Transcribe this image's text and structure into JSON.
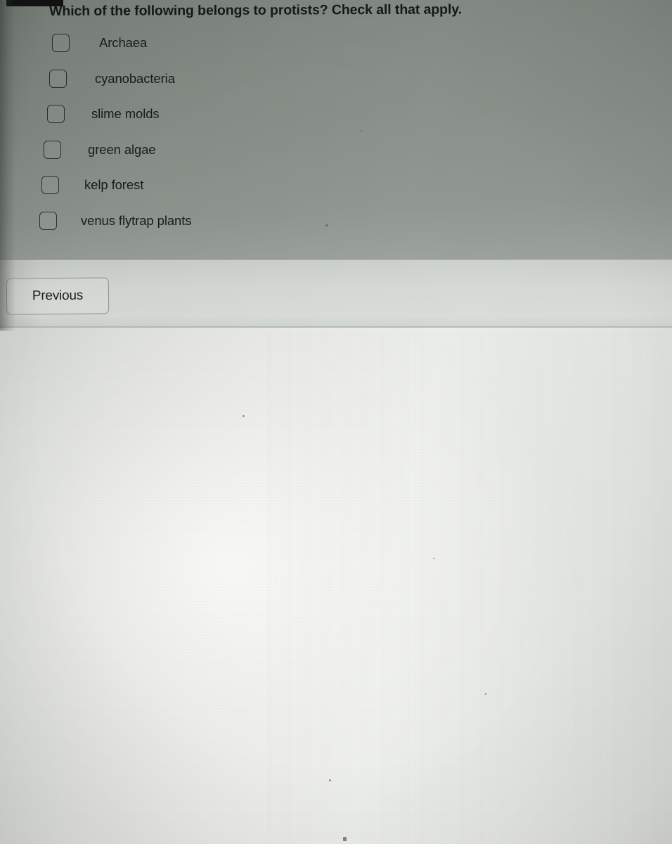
{
  "question": {
    "text": "Which of the following belongs to protists? Check all that apply.",
    "instruction": "Check all that apply."
  },
  "options": [
    {
      "label": "Archaea",
      "checked": false
    },
    {
      "label": "cyanobacteria",
      "checked": false
    },
    {
      "label": "slime molds",
      "checked": false
    },
    {
      "label": "green algae",
      "checked": false
    },
    {
      "label": "kelp forest",
      "checked": false
    },
    {
      "label": "venus flytrap plants",
      "checked": false
    }
  ],
  "footer": {
    "previous_label": "Previous"
  },
  "colors": {
    "panel_background": "#848c85",
    "footer_background": "#d2d6d2",
    "surface_background": "#e6e7e2",
    "text": "#191d1a",
    "checkbox_border": "#2c302d",
    "button_border": "#8d918d",
    "redaction_bar": "#131313",
    "divider": "#6e7470"
  }
}
